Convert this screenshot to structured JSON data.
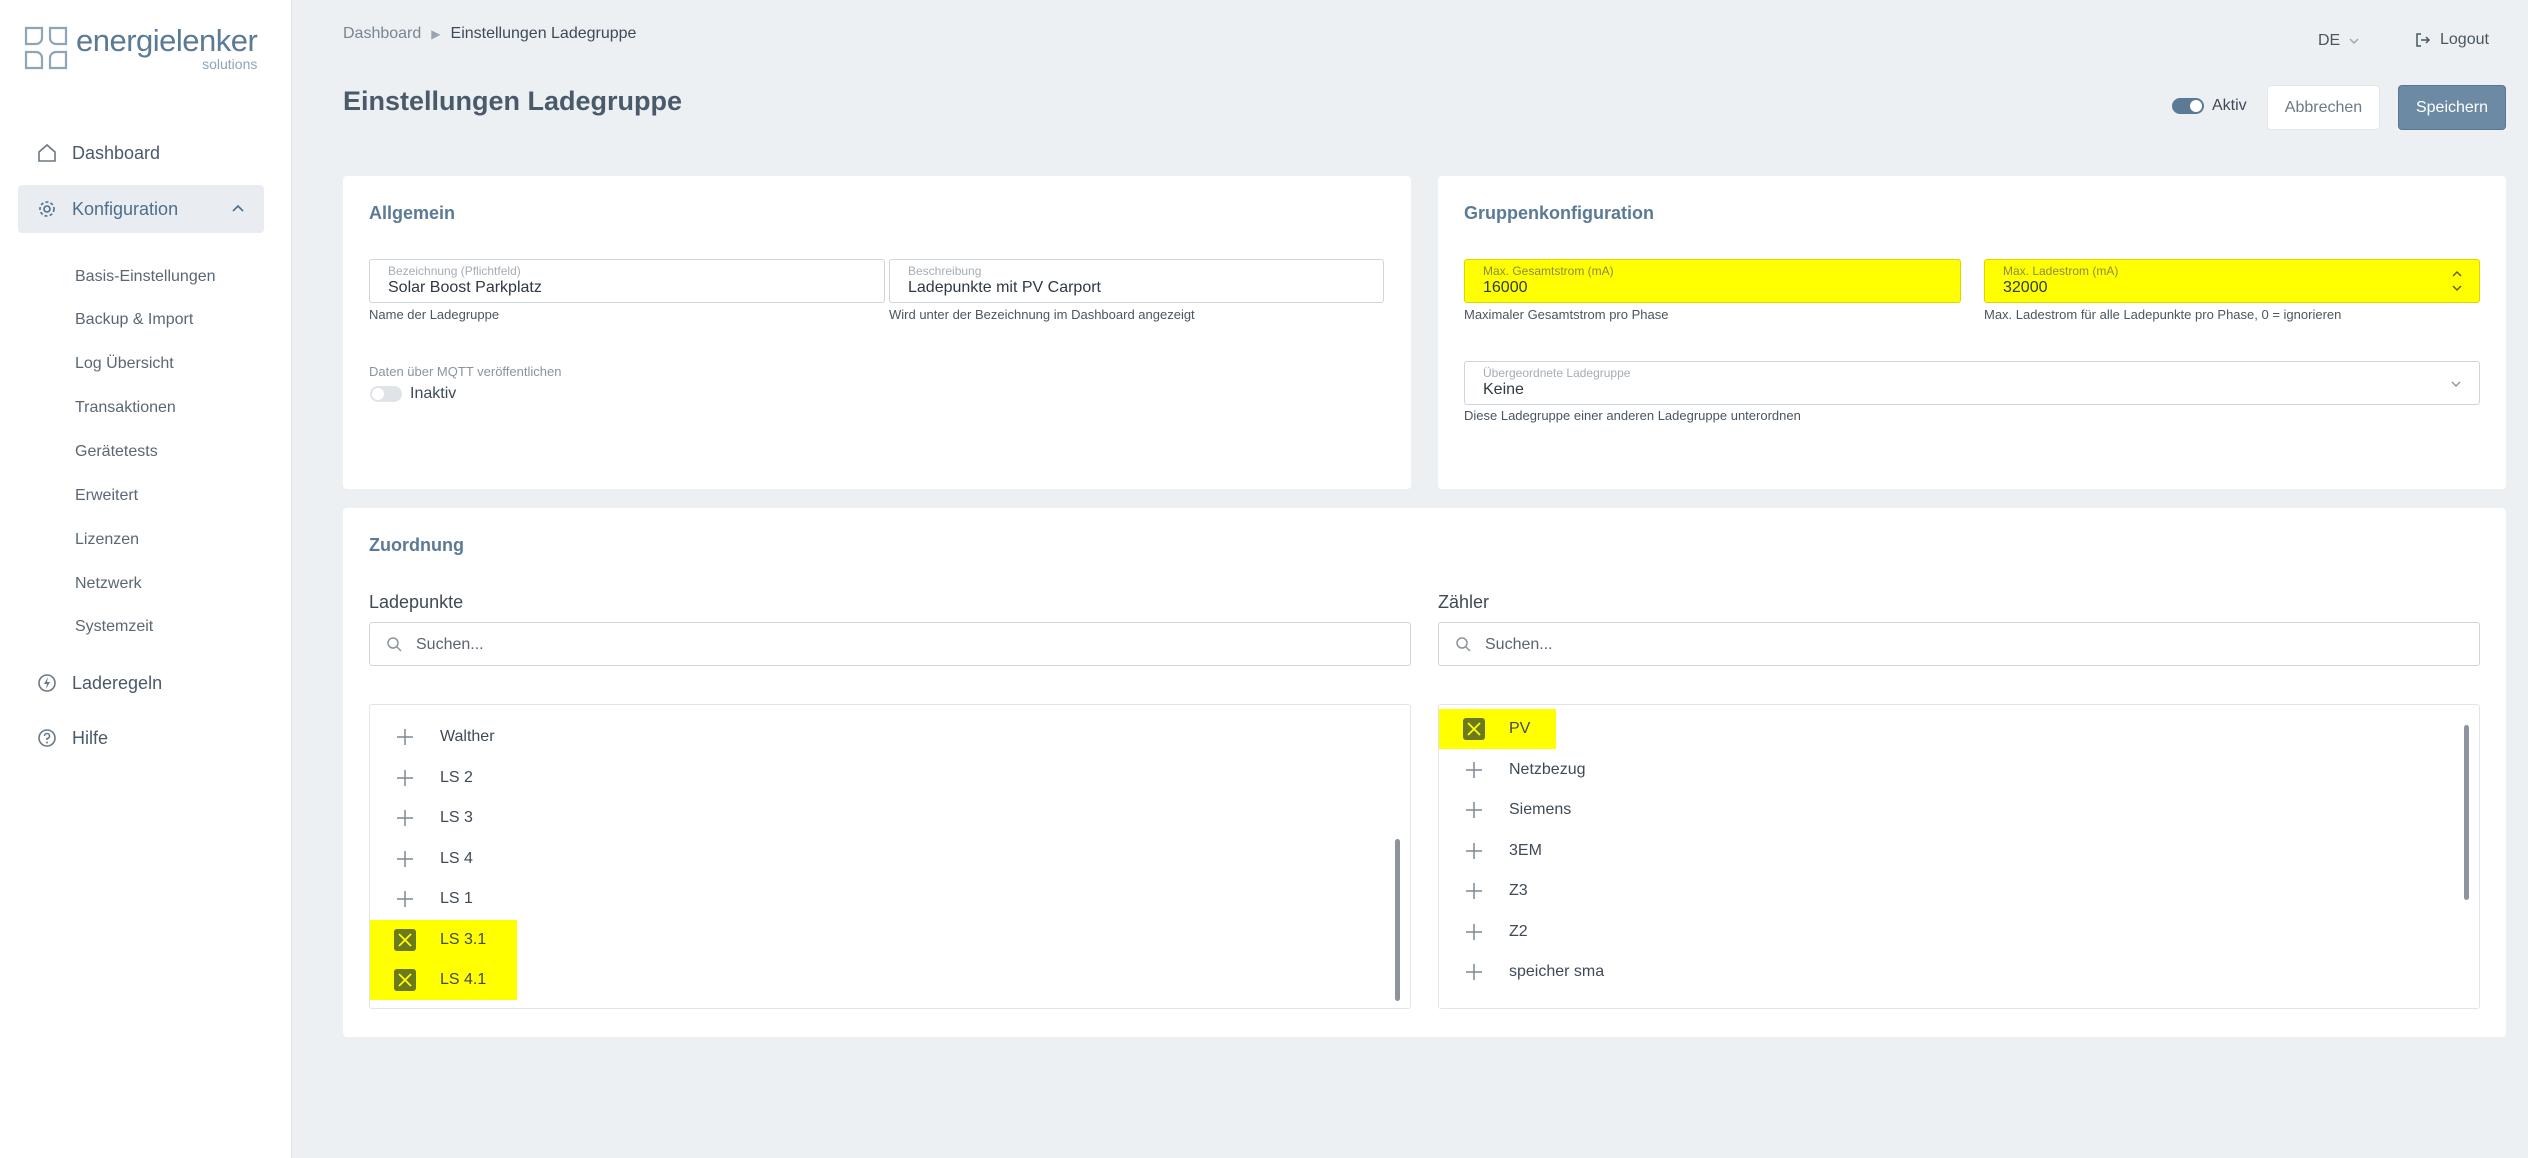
{
  "app": {
    "brand_name": "energielenker",
    "brand_sub": "solutions"
  },
  "sidebar": {
    "dashboard": "Dashboard",
    "konfiguration": "Konfiguration",
    "sub_items": [
      "Basis-Einstellungen",
      "Backup & Import",
      "Log Übersicht",
      "Transaktionen",
      "Gerätetests",
      "Erweitert",
      "Lizenzen",
      "Netzwerk",
      "Systemzeit"
    ],
    "laderegeln": "Laderegeln",
    "hilfe": "Hilfe"
  },
  "header": {
    "breadcrumb_root": "Dashboard",
    "breadcrumb_current": "Einstellungen Ladegruppe",
    "language": "DE",
    "logout": "Logout",
    "page_title": "Einstellungen Ladegruppe",
    "active_label": "Aktiv",
    "active_state": true,
    "cancel": "Abbrechen",
    "save": "Speichern"
  },
  "allgemein": {
    "title": "Allgemein",
    "name_label": "Bezeichnung (Pflichtfeld)",
    "name_value": "Solar Boost Parkplatz",
    "name_hint": "Name der Ladegruppe",
    "desc_label": "Beschreibung",
    "desc_value": "Ladepunkte mit PV Carport",
    "desc_hint": "Wird unter der Bezeichnung im Dashboard angezeigt",
    "mqtt_label": "Daten über MQTT veröffentlichen",
    "mqtt_state_label": "Inaktiv",
    "mqtt_state": false
  },
  "gruppe": {
    "title": "Gruppenkonfiguration",
    "max_total_label": "Max. Gesamtstrom (mA)",
    "max_total_value": "16000",
    "max_total_hint": "Maximaler Gesamtstrom pro Phase",
    "max_charge_label": "Max. Ladestrom (mA)",
    "max_charge_value": "32000",
    "max_charge_hint": "Max. Ladestrom für alle Ladepunkte pro Phase, 0 = ignorieren",
    "parent_label": "Übergeordnete Ladegruppe",
    "parent_value": "Keine",
    "parent_hint": "Diese Ladegruppe einer anderen Ladegruppe unterordnen"
  },
  "zuordnung": {
    "title": "Zuordnung",
    "ladepunkte_label": "Ladepunkte",
    "zaehler_label": "Zähler",
    "search_placeholder": "Suchen...",
    "ladepunkte": [
      {
        "name": "Walther",
        "selected": false
      },
      {
        "name": "LS 2",
        "selected": false
      },
      {
        "name": "LS 3",
        "selected": false
      },
      {
        "name": "LS 4",
        "selected": false
      },
      {
        "name": "LS 1",
        "selected": false
      },
      {
        "name": "LS 3.1",
        "selected": true
      },
      {
        "name": "LS 4.1",
        "selected": true
      }
    ],
    "zaehler": [
      {
        "name": "PV",
        "selected": true
      },
      {
        "name": "Netzbezug",
        "selected": false
      },
      {
        "name": "Siemens",
        "selected": false
      },
      {
        "name": "3EM",
        "selected": false
      },
      {
        "name": "Z3",
        "selected": false
      },
      {
        "name": "Z2",
        "selected": false
      },
      {
        "name": "speicher sma",
        "selected": false
      }
    ]
  },
  "colors": {
    "accent": "#5b7a95",
    "highlight": "#ffff00",
    "selected_icon": "#6b7a1e"
  }
}
